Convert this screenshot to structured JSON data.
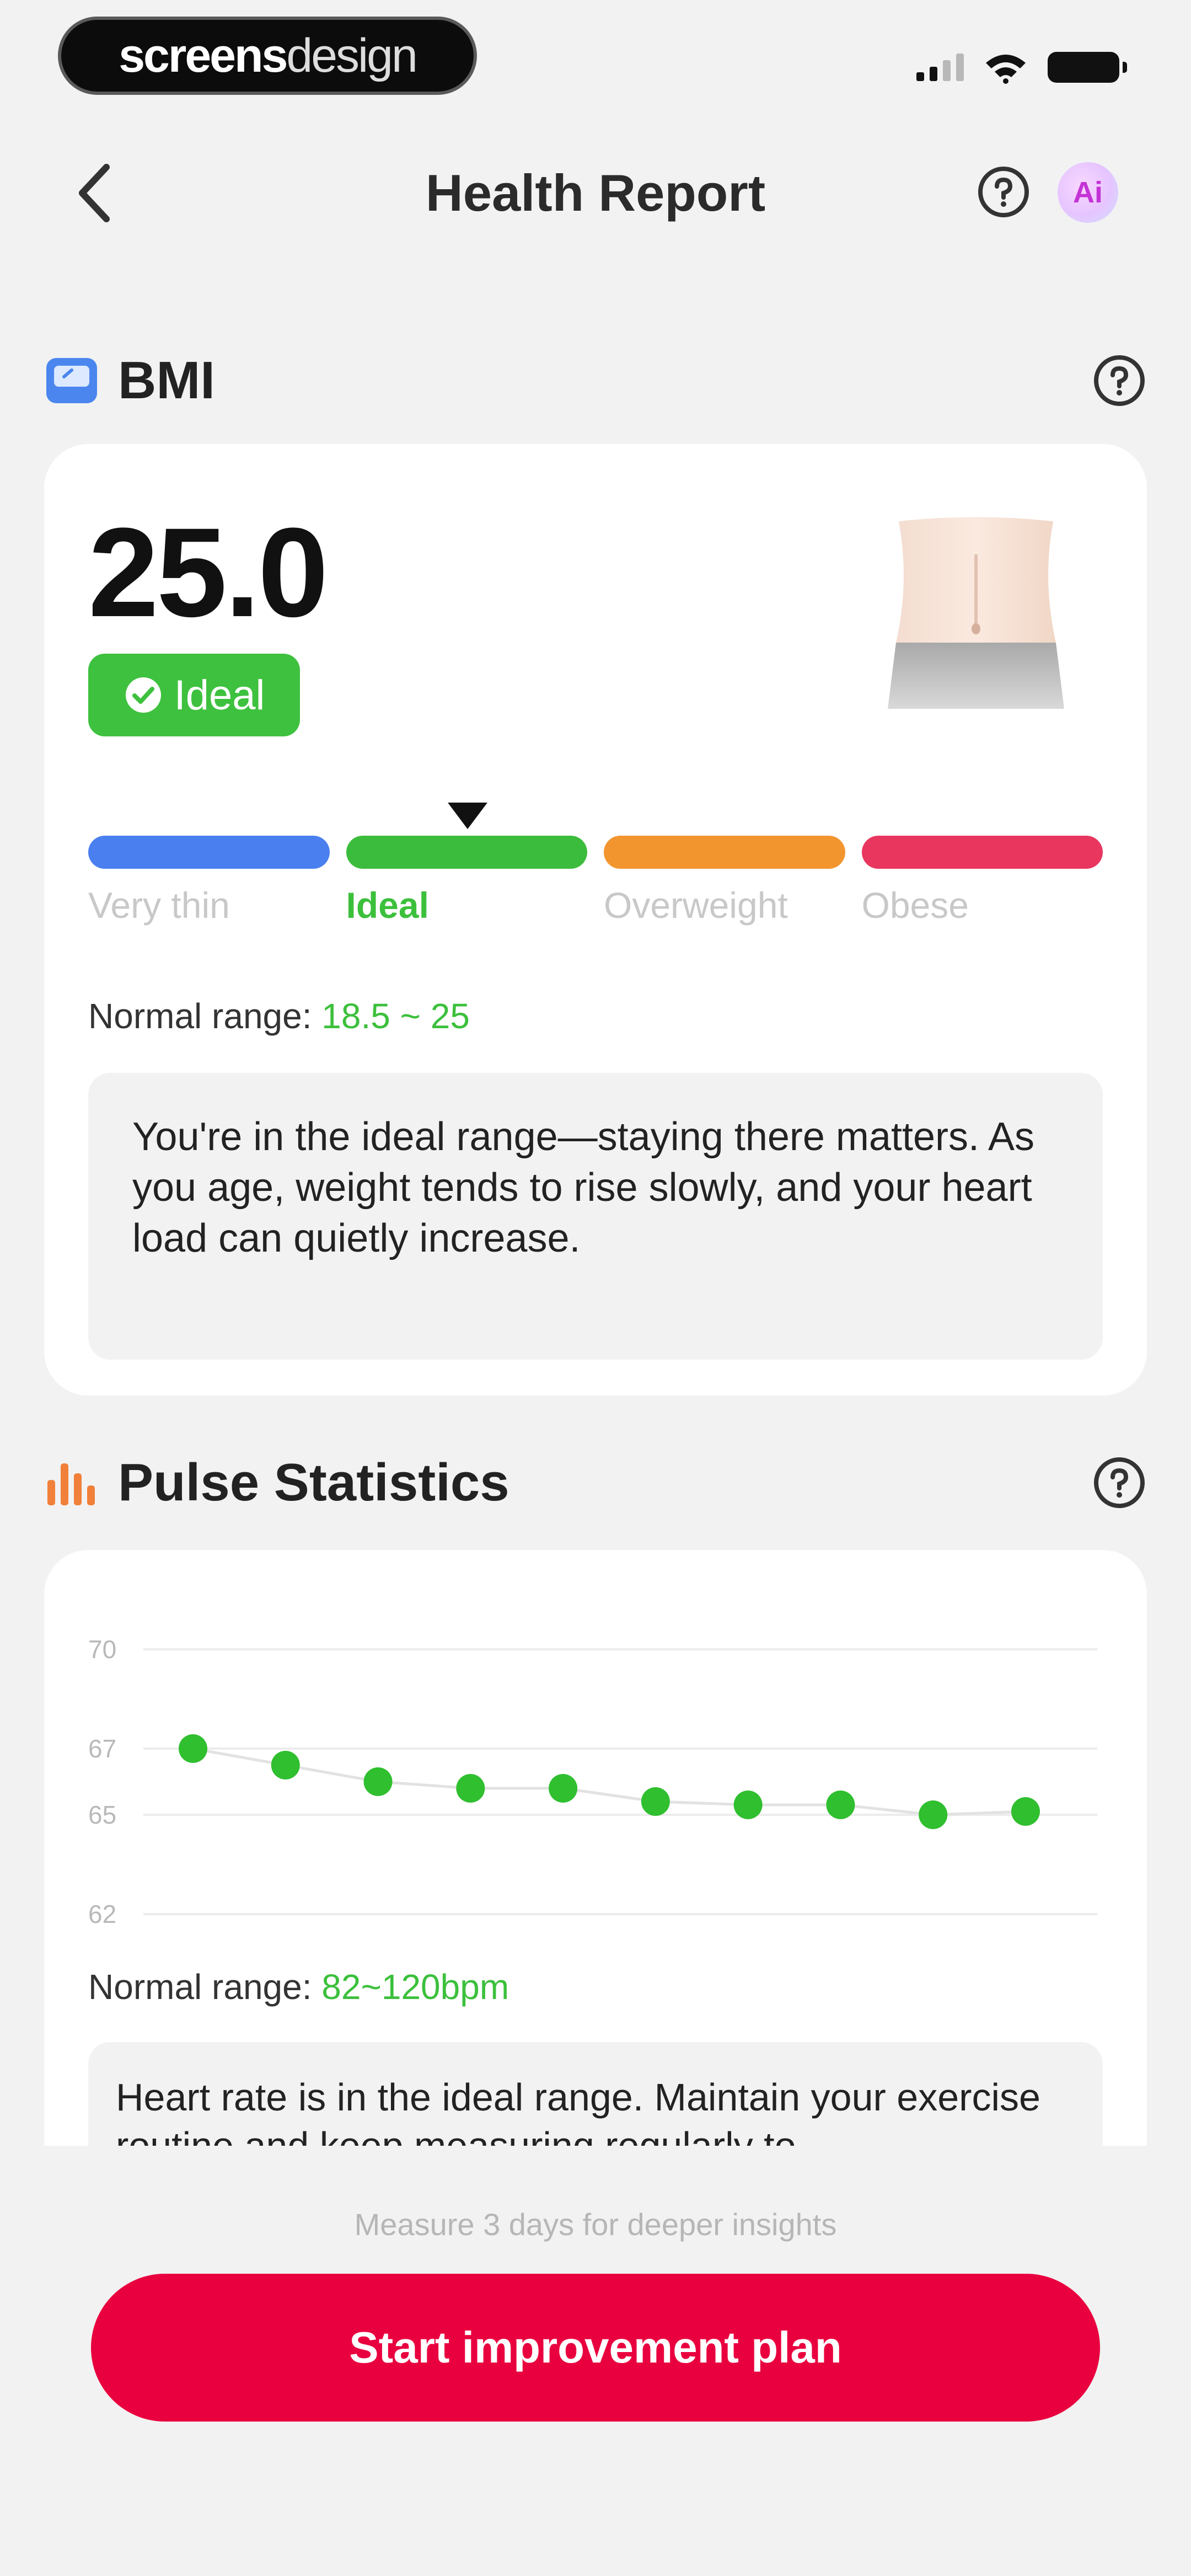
{
  "status_bar": {
    "brand_bold": "screens",
    "brand_thin": "design"
  },
  "nav": {
    "title": "Health Report",
    "ai_label": "Ai"
  },
  "bmi": {
    "section_title": "BMI",
    "value": "25.0",
    "badge": "Ideal",
    "scale": [
      {
        "label": "Very thin",
        "color": "#4a7ff0"
      },
      {
        "label": "Ideal",
        "color": "#3cbc3c"
      },
      {
        "label": "Overweight",
        "color": "#f2952f"
      },
      {
        "label": "Obese",
        "color": "#e8365f"
      }
    ],
    "range_label": "Normal range:",
    "range_value": "18.5 ~ 25",
    "advice": "You're in the ideal range—staying there matters. As you age, weight tends to rise slowly, and your heart load can quietly increase."
  },
  "pulse": {
    "section_title": "Pulse Statistics",
    "range_label": "Normal range:",
    "range_value": "82~120bpm",
    "note": "Heart rate is in the ideal range. Maintain your exercise routine and keep measuring regularly to"
  },
  "chart_data": {
    "type": "scatter",
    "title": "",
    "xlabel": "",
    "ylabel": "",
    "yticks": [
      "70",
      "67",
      "65",
      "62"
    ],
    "ylim": [
      62,
      70
    ],
    "grid": true,
    "trendline": true,
    "color": "#2fbf2f",
    "x": [
      1,
      2,
      3,
      4,
      5,
      6,
      7,
      8,
      9,
      10
    ],
    "y": [
      67.0,
      66.5,
      66.0,
      65.8,
      65.8,
      65.4,
      65.3,
      65.3,
      65.0,
      65.1
    ]
  },
  "footer": {
    "insight": "Measure 3 days for deeper insights",
    "cta": "Start improvement plan"
  },
  "colors": {
    "accent_green": "#3cc03c",
    "cta_red": "#e9003f"
  }
}
